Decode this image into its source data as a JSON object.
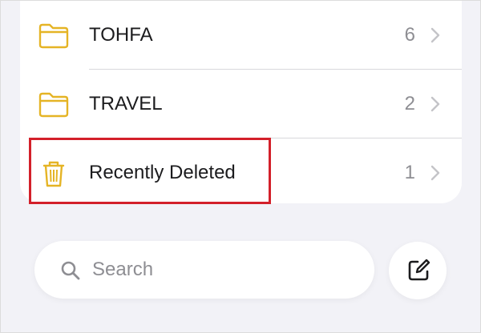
{
  "folders": [
    {
      "label": "TOHFA",
      "count": "6",
      "icon": "folder-icon"
    },
    {
      "label": "TRAVEL",
      "count": "2",
      "icon": "folder-icon"
    },
    {
      "label": "Recently Deleted",
      "count": "1",
      "icon": "trash-icon"
    }
  ],
  "search": {
    "placeholder": "Search",
    "icon": "search-icon"
  },
  "compose": {
    "icon": "compose-icon"
  },
  "colors": {
    "accent": "#e5b425",
    "highlight": "#d3202a",
    "secondary_text": "#8e8e93",
    "background": "#f2f2f7"
  }
}
